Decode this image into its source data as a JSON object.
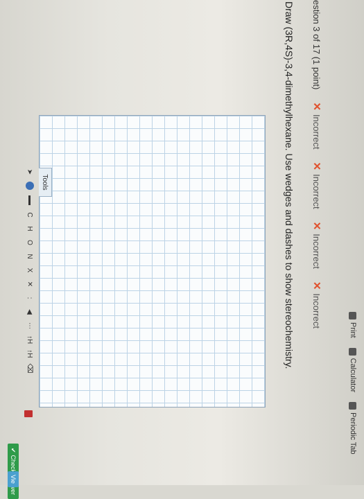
{
  "toolbar": {
    "print": "Print",
    "calculator": "Calculator",
    "periodic_table": "Periodic Tab"
  },
  "question": {
    "number_text": "estion 3 of 17 (1 point)",
    "attempts": [
      "Incorrect",
      "Incorrect",
      "Incorrect",
      "Incorrect"
    ],
    "prompt": "Draw (3R,4S)-3,4-dimethylhexane. Use wedges and dashes to show stereochemistry."
  },
  "tools": {
    "tab_label": "Tools",
    "elements": [
      "C",
      "H",
      "O",
      "N",
      "X"
    ],
    "extra_labels": [
      ":",
      "↑H",
      "↑H"
    ]
  },
  "actions": {
    "check_answer": "Check Answer",
    "view": "Vie"
  },
  "colors": {
    "incorrect": "#e0522e",
    "grid": "#bcd3e6",
    "check": "#2f9b4a"
  }
}
